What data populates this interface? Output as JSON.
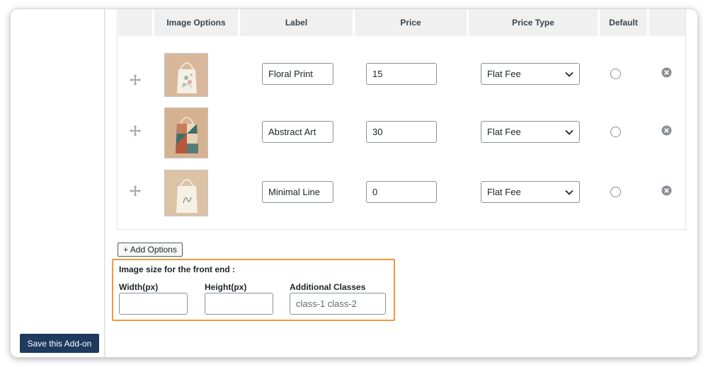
{
  "table": {
    "headers": [
      "",
      "Image Options",
      "Label",
      "Price",
      "Price Type",
      "Default",
      ""
    ],
    "rows": [
      {
        "image": "tote-bag-floral-print",
        "label": "Floral Print",
        "price": "15",
        "price_type": "Flat Fee"
      },
      {
        "image": "tote-bag-abstract-art",
        "label": "Abstract Art",
        "price": "30",
        "price_type": "Flat Fee"
      },
      {
        "image": "tote-bag-minimal-line",
        "label": "Minimal Line",
        "price": "0",
        "price_type": "Flat Fee"
      }
    ]
  },
  "add_options_label": "+ Add Options",
  "image_size": {
    "title": "Image size for the front end :",
    "width_label": "Width(px)",
    "height_label": "Height(px)",
    "classes_label": "Additional Classes",
    "width_value": "",
    "height_value": "",
    "classes_placeholder": "class-1 class-2"
  },
  "save_label": "Save this Add-on",
  "colors": {
    "highlight_border": "#ef9a3a",
    "primary_button": "#1e3a5f",
    "header_bg": "#f0f0f1"
  }
}
